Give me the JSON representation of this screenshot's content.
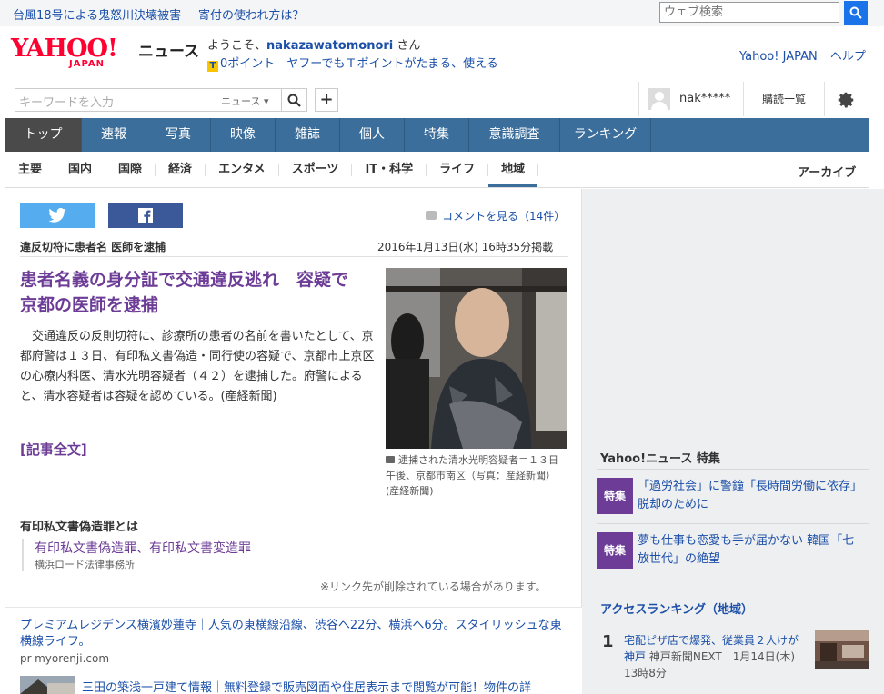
{
  "topbar": {
    "headline1": "台風18号による鬼怒川決壊被害",
    "headline2": "寄付の使われ方は？",
    "web_search_placeholder": "ウェブ検索"
  },
  "header": {
    "logo_text": "YAHOO!",
    "logo_sub": "JAPAN",
    "section_name": "ニュース",
    "welcome_prefix": "ようこそ、",
    "username": "nakazawatomonori",
    "welcome_suffix": " さん",
    "points": "0ポイント　ヤフーでもＴポイントがたまる、使える",
    "link_yahoo": "Yahoo! JAPAN",
    "link_help": "ヘルプ"
  },
  "search": {
    "placeholder": "キーワードを入力",
    "scope": "ニュース ▾"
  },
  "user": {
    "masked_name": "nak*****",
    "subscriptions": "購読一覧"
  },
  "main_nav": [
    {
      "label": "トップ",
      "active": true
    },
    {
      "label": "速報"
    },
    {
      "label": "写真"
    },
    {
      "label": "映像"
    },
    {
      "label": "雑誌"
    },
    {
      "label": "個人"
    },
    {
      "label": "特集"
    },
    {
      "label": "意識調査"
    },
    {
      "label": "ランキング"
    }
  ],
  "sub_nav": [
    "主要",
    "国内",
    "国際",
    "経済",
    "エンタメ",
    "スポーツ",
    "IT・科学",
    "ライフ",
    "地域"
  ],
  "sub_nav_active": "地域",
  "archive": "アーカイブ",
  "article": {
    "comments_link": "コメントを見る（14件）",
    "kicker": "違反切符に患者名 医師を逮捕",
    "published": "2016年1月13日(水) 16時35分掲載",
    "headline": "患者名義の身分証で交通違反逃れ　容疑で京都の医師を逮捕",
    "body": "　交通違反の反則切符に、診療所の患者の名前を書いたとして、京都府警は１３日、有印私文書偽造・同行使の容疑で、京都市上京区の心療内科医、清水光明容疑者（４２）を逮捕した。府警によると、清水容疑者は容疑を認めている。(産経新聞)",
    "full_text_link": "[記事全文]",
    "photo_caption": "逮捕された清水光明容疑者＝１３日午後、京都市南区（写真：産経新聞）(産経新聞)",
    "related_title": "有印私文書偽造罪とは",
    "related_link": "有印私文書偽造罪、有印私文書変造罪",
    "related_source": "横浜ロード法律事務所",
    "link_note": "※リンク先が削除されている場合があります。"
  },
  "ads": [
    {
      "title": "プレミアムレジデンス横濱妙蓮寺｜人気の東横線沿線、渋谷へ22分、横浜へ6分。スタイリッシュな東横線ライフ。",
      "url": "pr-myorenji.com"
    },
    {
      "title": "三田の築浅一戸建て情報｜無料登録で販売図面や住居表示まで閲覧が可能！物件の詳"
    }
  ],
  "features": {
    "title": "Yahoo!ニュース 特集",
    "badge": "特集",
    "items": [
      "「過労社会」に警鐘「長時間労働に依存」脱却のために",
      "夢も仕事も恋愛も手が届かない 韓国「七放世代」の絶望"
    ]
  },
  "ranking": {
    "title": "アクセスランキング（地域）",
    "items": [
      {
        "rank": "1",
        "title": "宅配ピザ店で爆発、従業員２人けが　神戸",
        "meta": "神戸新聞NEXT　1月14日(木) 13時8分"
      }
    ]
  },
  "colors": {
    "nav_blue": "#3c6e9b",
    "headline_purple": "#6c3c96",
    "link_blue": "#1b4fa8",
    "yahoo_red": "#ff0033"
  }
}
